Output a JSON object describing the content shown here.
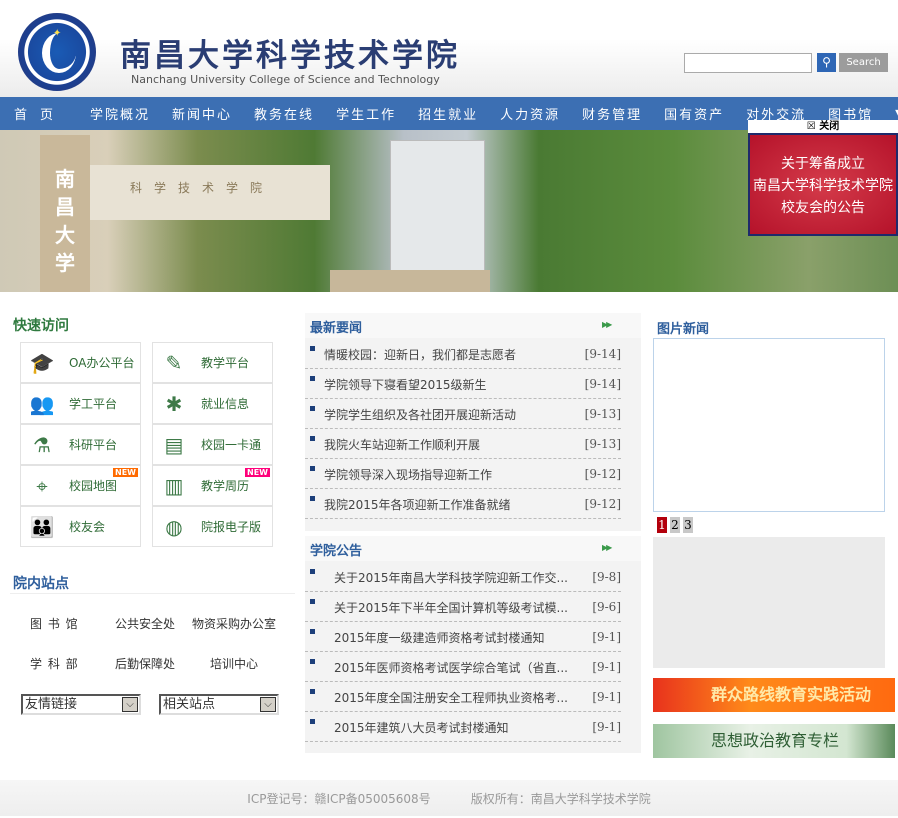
{
  "header": {
    "title_cn": "南昌大学科学技术学院",
    "title_en": "Nanchang University College of Science and Technology",
    "search_placeholder": "",
    "search_button": "Search",
    "logo_text": "南昌大学科学技术学院 Nanchang University"
  },
  "nav": {
    "items": [
      "首页",
      "学院概况",
      "新闻中心",
      "教务在线",
      "学生工作",
      "招生就业",
      "人力资源",
      "财务管理",
      "国有资产",
      "对外交流",
      "图书馆"
    ],
    "more_icon": "triangle-down"
  },
  "banner": {
    "gate_text": "南昌大学",
    "beam_text": "科学技术学院"
  },
  "popup": {
    "close_label": "关闭",
    "lines": [
      "关于筹备成立",
      "南昌大学科学技术学院",
      "校友会的公告"
    ]
  },
  "quick_access": {
    "title": "快速访问",
    "new_badge": "NEW",
    "items": [
      {
        "label": "OA办公平台",
        "icon": "graduate-icon"
      },
      {
        "label": "教学平台",
        "icon": "pencil-icon"
      },
      {
        "label": "学工平台",
        "icon": "users-icon"
      },
      {
        "label": "就业信息",
        "icon": "asterisk-icon"
      },
      {
        "label": "科研平台",
        "icon": "flask-icon"
      },
      {
        "label": "校园一卡通",
        "icon": "card-icon"
      },
      {
        "label": "校园地图",
        "icon": "map-icon",
        "badge": true,
        "badge_color": "#ff6a00"
      },
      {
        "label": "教学周历",
        "icon": "book-icon",
        "badge": true,
        "badge_color": "#ff007a"
      },
      {
        "label": "校友会",
        "icon": "group-icon"
      },
      {
        "label": "院报电子版",
        "icon": "globe-icon"
      }
    ]
  },
  "sites": {
    "title": "院内站点",
    "links": [
      "图 书 馆",
      "公共安全处",
      "物资采购办公室",
      "学 科 部",
      "后勤保障处",
      "培训中心"
    ],
    "select1": "友情链接",
    "select2": "相关站点"
  },
  "news": {
    "title": "最新要闻",
    "items": [
      {
        "title": "情暖校园：迎新日，我们都是志愿者",
        "date": "[9-14]"
      },
      {
        "title": "学院领导下寝看望2015级新生",
        "date": "[9-14]"
      },
      {
        "title": "学院学生组织及各社团开展迎新活动",
        "date": "[9-13]"
      },
      {
        "title": "我院火车站迎新工作顺利开展",
        "date": "[9-13]"
      },
      {
        "title": "学院领导深入现场指导迎新工作",
        "date": "[9-12]"
      },
      {
        "title": "我院2015年各项迎新工作准备就绪",
        "date": "[9-12]"
      }
    ]
  },
  "notices": {
    "title": "学院公告",
    "items": [
      {
        "title": "关于2015年南昌大学科技学院迎新工作交...",
        "date": "[9-8]"
      },
      {
        "title": "关于2015年下半年全国计算机等级考试模...",
        "date": "[9-6]"
      },
      {
        "title": "2015年度一级建造师资格考试封楼通知",
        "date": "[9-1]"
      },
      {
        "title": "2015年医师资格考试医学综合笔试（省直...",
        "date": "[9-1]"
      },
      {
        "title": "2015年度全国注册安全工程师执业资格考...",
        "date": "[9-1]"
      },
      {
        "title": "2015年建筑八大员考试封楼通知",
        "date": "[9-1]"
      }
    ]
  },
  "photo_news": {
    "title": "图片新闻",
    "pages": [
      "1",
      "2",
      "3"
    ],
    "current_page": 1
  },
  "banners": [
    "群众路线教育实践活动",
    "思想政治教育专栏"
  ],
  "footer": {
    "icp": "ICP登记号：赣ICP备05005608号",
    "copyright": "版权所有：南昌大学科学技术学院"
  }
}
